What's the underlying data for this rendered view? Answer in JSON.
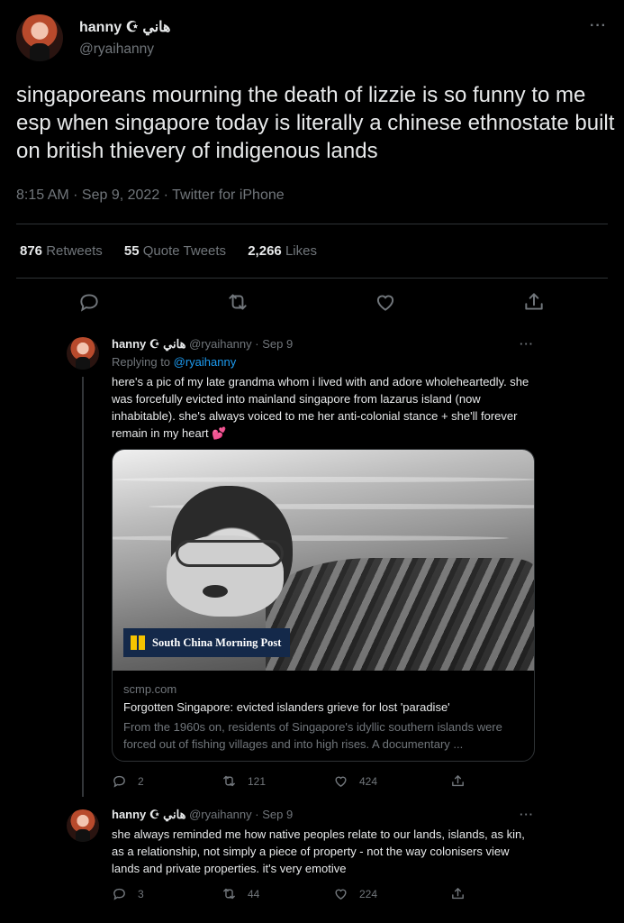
{
  "main_tweet": {
    "name": "hanny ☪ هاني",
    "handle": "@ryaihanny",
    "text": "singaporeans mourning the death of lizzie is so funny to me esp when singapore today is literally a chinese ethnostate built on british thievery of indigenous lands",
    "meta": "8:15 AM · Sep 9, 2022 · Twitter for iPhone",
    "more_label": "···",
    "stats": {
      "retweets_count": "876",
      "retweets_label": "Retweets",
      "quotes_count": "55",
      "quotes_label": "Quote Tweets",
      "likes_count": "2,266",
      "likes_label": "Likes"
    }
  },
  "reply1": {
    "name": "hanny ☪ هاني",
    "handle_date": "@ryaihanny · Sep 9",
    "more_label": "···",
    "replying_prefix": "Replying to ",
    "replying_handle": "@ryaihanny",
    "text": "here's a pic of my late grandma whom i lived with and adore wholeheartedly. she was forcefully evicted into mainland singapore from lazarus island (now inhabitable). she's always voiced to me her anti-colonial stance + she'll forever remain in my heart 💕",
    "card": {
      "logo_text": "South China Morning Post",
      "domain": "scmp.com",
      "title": "Forgotten Singapore: evicted islanders grieve for lost 'paradise'",
      "description": "From the 1960s on, residents of Singapore's idyllic southern islands were forced out of fishing villages and into high rises. A documentary ..."
    },
    "replies": "2",
    "retweets": "121",
    "likes": "424"
  },
  "reply2": {
    "name": "hanny ☪ هاني",
    "handle_date": "@ryaihanny · Sep 9",
    "more_label": "···",
    "text": "she always reminded me how native peoples relate to our lands, islands, as kin, as a relationship, not simply a piece of property - not the way colonisers view lands and private properties. it's very emotive",
    "replies": "3",
    "retweets": "44",
    "likes": "224"
  }
}
